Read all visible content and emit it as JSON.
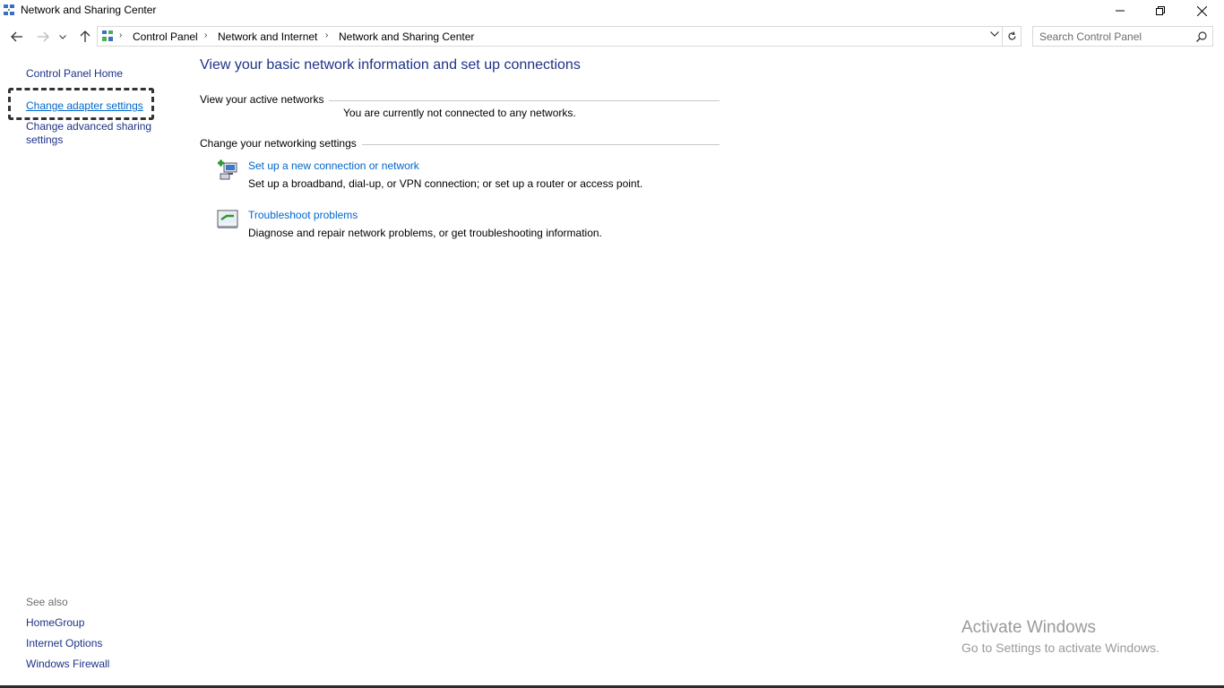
{
  "window": {
    "title": "Network and Sharing Center"
  },
  "address_bar": {
    "breadcrumbs": [
      "Control Panel",
      "Network and Internet",
      "Network and Sharing Center"
    ]
  },
  "search": {
    "placeholder": "Search Control Panel"
  },
  "left_pane": {
    "home_link": "Control Panel Home",
    "change_adapter": "Change adapter settings",
    "change_sharing": "Change advanced sharing settings",
    "see_also_label": "See also",
    "see_also": [
      "HomeGroup",
      "Internet Options",
      "Windows Firewall"
    ]
  },
  "main": {
    "title": "View your basic network information and set up connections",
    "active_networks": {
      "heading": "View your active networks",
      "status": "You are currently not connected to any networks."
    },
    "networking_settings": {
      "heading": "Change your networking settings",
      "tasks": [
        {
          "icon": "new-connection-icon",
          "link": "Set up a new connection or network",
          "description": "Set up a broadband, dial-up, or VPN connection; or set up a router or access point."
        },
        {
          "icon": "troubleshoot-icon",
          "link": "Troubleshoot problems",
          "description": "Diagnose and repair network problems, or get troubleshooting information."
        }
      ]
    }
  },
  "watermark": {
    "title": "Activate Windows",
    "subtitle": "Go to Settings to activate Windows."
  },
  "colors": {
    "link": "#0066cc",
    "nav_link": "#1e3287",
    "title": "#1e3287",
    "watermark": "#9a9a9a"
  }
}
